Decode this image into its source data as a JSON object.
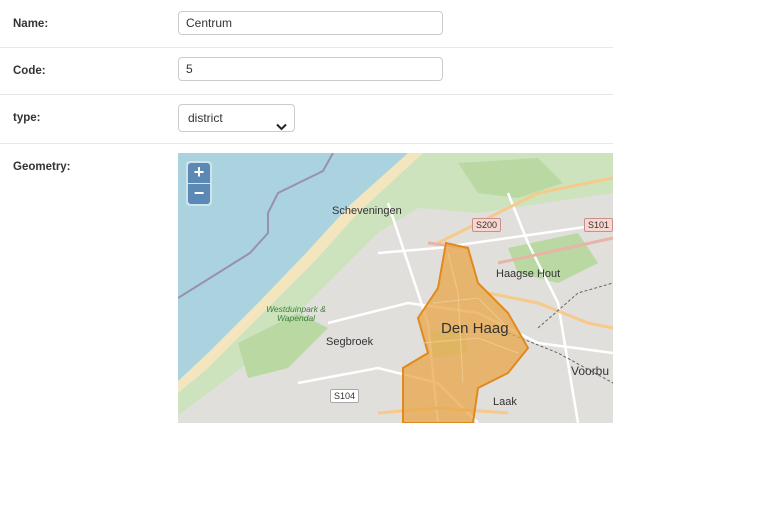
{
  "form": {
    "name": {
      "label": "Name:",
      "value": "Centrum"
    },
    "code": {
      "label": "Code:",
      "value": "5"
    },
    "type": {
      "label": "type:",
      "selected": "district"
    },
    "geometry": {
      "label": "Geometry:"
    }
  },
  "map": {
    "zoom_in": "+",
    "zoom_out": "−",
    "labels": {
      "scheveningen": "Scheveningen",
      "den_haag": "Den Haag",
      "haagse_hout": "Haagse Hout",
      "segbroek": "Segbroek",
      "voorburg": "Voorbu",
      "laak": "Laak",
      "park": "Westduinpark & Wapendal"
    },
    "shields": {
      "s200": "S200",
      "s101": "S101",
      "s104": "S104"
    },
    "colors": {
      "sea": "#aad3df",
      "beach": "#f5e9c6",
      "dunes": "#c8dfb4",
      "urban": "#dcdcdc",
      "district_fill": "#e8a548",
      "district_stroke": "#e08a1e"
    }
  }
}
